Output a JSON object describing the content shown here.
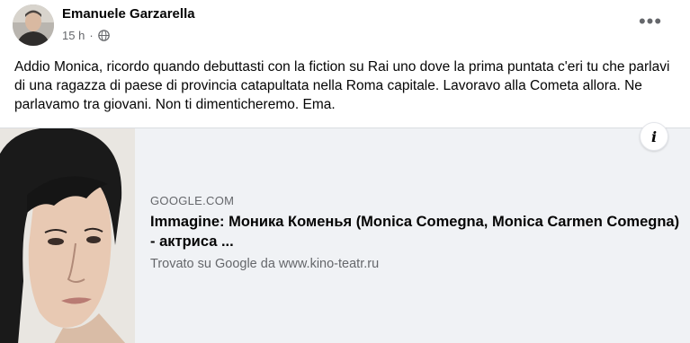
{
  "post": {
    "author": "Emanuele Garzarella",
    "time": "15 h",
    "separator": "·",
    "privacy_icon": "globe-icon",
    "more_label": "•••",
    "text": "Addio Monica, ricordo quando debuttasti con la fiction su Rai uno dove la prima puntata c'eri tu che parlavi di una ragazza di paese di provincia catapultata nella Roma capitale. Lavoravo alla Cometa allora. Ne parlavamo tra giovani. Non ti dimenticheremo. Ema."
  },
  "link_preview": {
    "info_label": "i",
    "domain": "GOOGLE.COM",
    "title": "Immagine: Моника Коменья (Monica Comegna, Monica Carmen Comegna) - актриса ...",
    "description": "Trovato su Google da www.kino-teatr.ru"
  },
  "colors": {
    "text_primary": "#050505",
    "text_secondary": "#65676b",
    "card_background": "#f0f2f5"
  }
}
